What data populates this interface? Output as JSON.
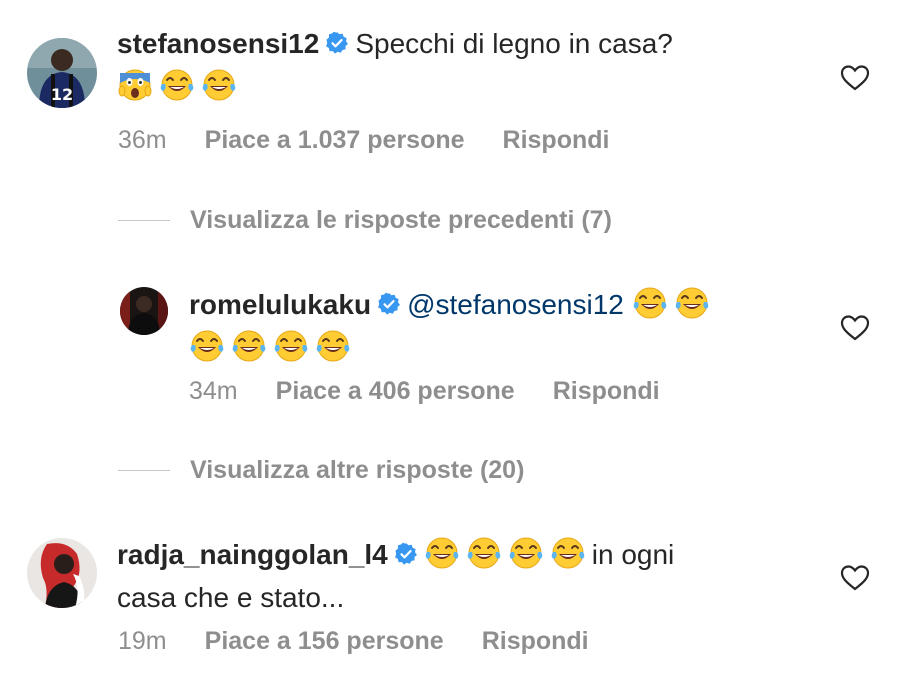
{
  "comments": [
    {
      "username": "stefanosensi12",
      "text": "Specchi di legno in casa?",
      "emojis": [
        "face-screaming-in-fear",
        "face-with-tears-of-joy",
        "face-with-tears-of-joy"
      ],
      "time": "36m",
      "likes": "Piace a 1.037 persone",
      "reply": "Rispondi",
      "avatar": "avatar-player-12"
    },
    {
      "thread_toggle": "Visualizza le risposte precedenti (7)",
      "username": "romelulukaku",
      "mention": "@stefanosensi12",
      "emojis": [
        "face-with-tears-of-joy",
        "face-with-tears-of-joy",
        "face-with-tears-of-joy",
        "face-with-tears-of-joy",
        "face-with-tears-of-joy",
        "face-with-tears-of-joy"
      ],
      "time": "34m",
      "likes": "Piace a 406 persone",
      "reply": "Rispondi",
      "avatar": "avatar-dark"
    },
    {
      "thread_toggle": "Visualizza altre risposte (20)",
      "username": "radja_nainggolan_l4",
      "text_line1": "in ogni",
      "text_line2": "casa che e stato...",
      "emojis": [
        "face-with-tears-of-joy",
        "face-with-tears-of-joy",
        "face-with-tears-of-joy",
        "face-with-tears-of-joy"
      ],
      "time": "19m",
      "likes": "Piace a 156 persone",
      "reply": "Rispondi",
      "avatar": "avatar-red-white"
    }
  ],
  "colors": {
    "text": "#262626",
    "secondary": "#8e8e8e",
    "verified": "#3897f0",
    "mention": "#00376b"
  }
}
